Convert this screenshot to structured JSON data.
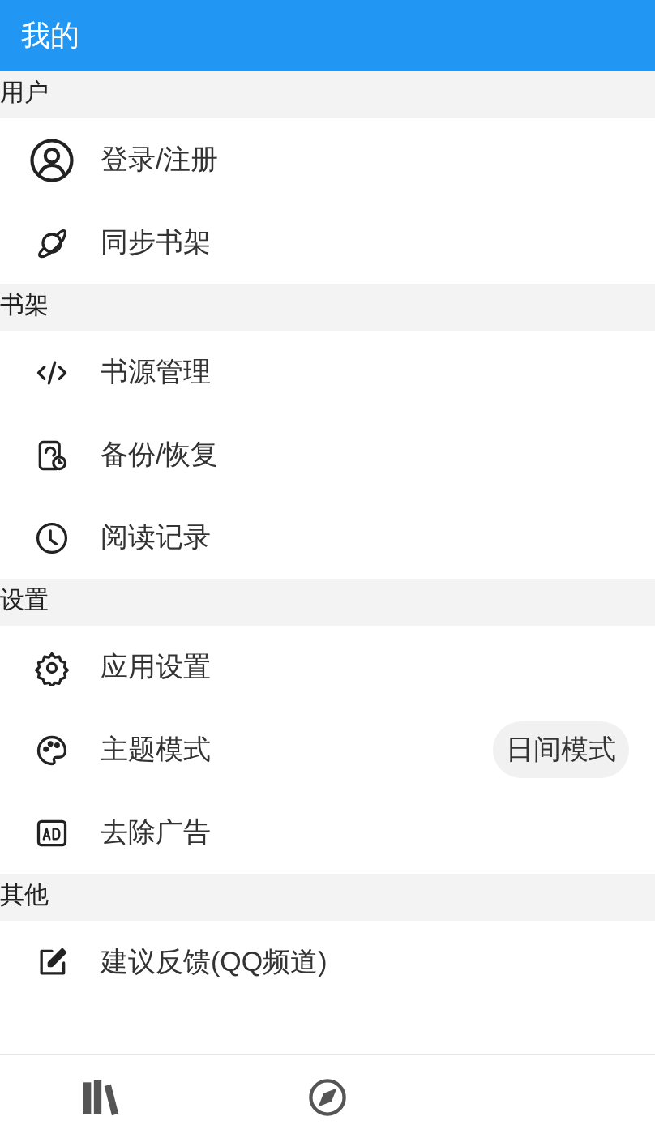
{
  "app_bar": {
    "title": "我的"
  },
  "sections": [
    {
      "title": "用户",
      "items": [
        {
          "kind": "user",
          "label": "登录/注册"
        },
        {
          "kind": "planet",
          "label": "同步书架"
        }
      ]
    },
    {
      "title": "书架",
      "items": [
        {
          "kind": "code",
          "label": "书源管理"
        },
        {
          "kind": "backup",
          "label": "备份/恢复"
        },
        {
          "kind": "clock",
          "label": "阅读记录"
        }
      ]
    },
    {
      "title": "设置",
      "items": [
        {
          "kind": "gear",
          "label": "应用设置"
        },
        {
          "kind": "palette",
          "label": "主题模式",
          "value": "日间模式"
        },
        {
          "kind": "ad",
          "label": "去除广告"
        }
      ]
    },
    {
      "title": "其他",
      "items": [
        {
          "kind": "edit",
          "label": "建议反馈(QQ频道)"
        }
      ]
    }
  ]
}
